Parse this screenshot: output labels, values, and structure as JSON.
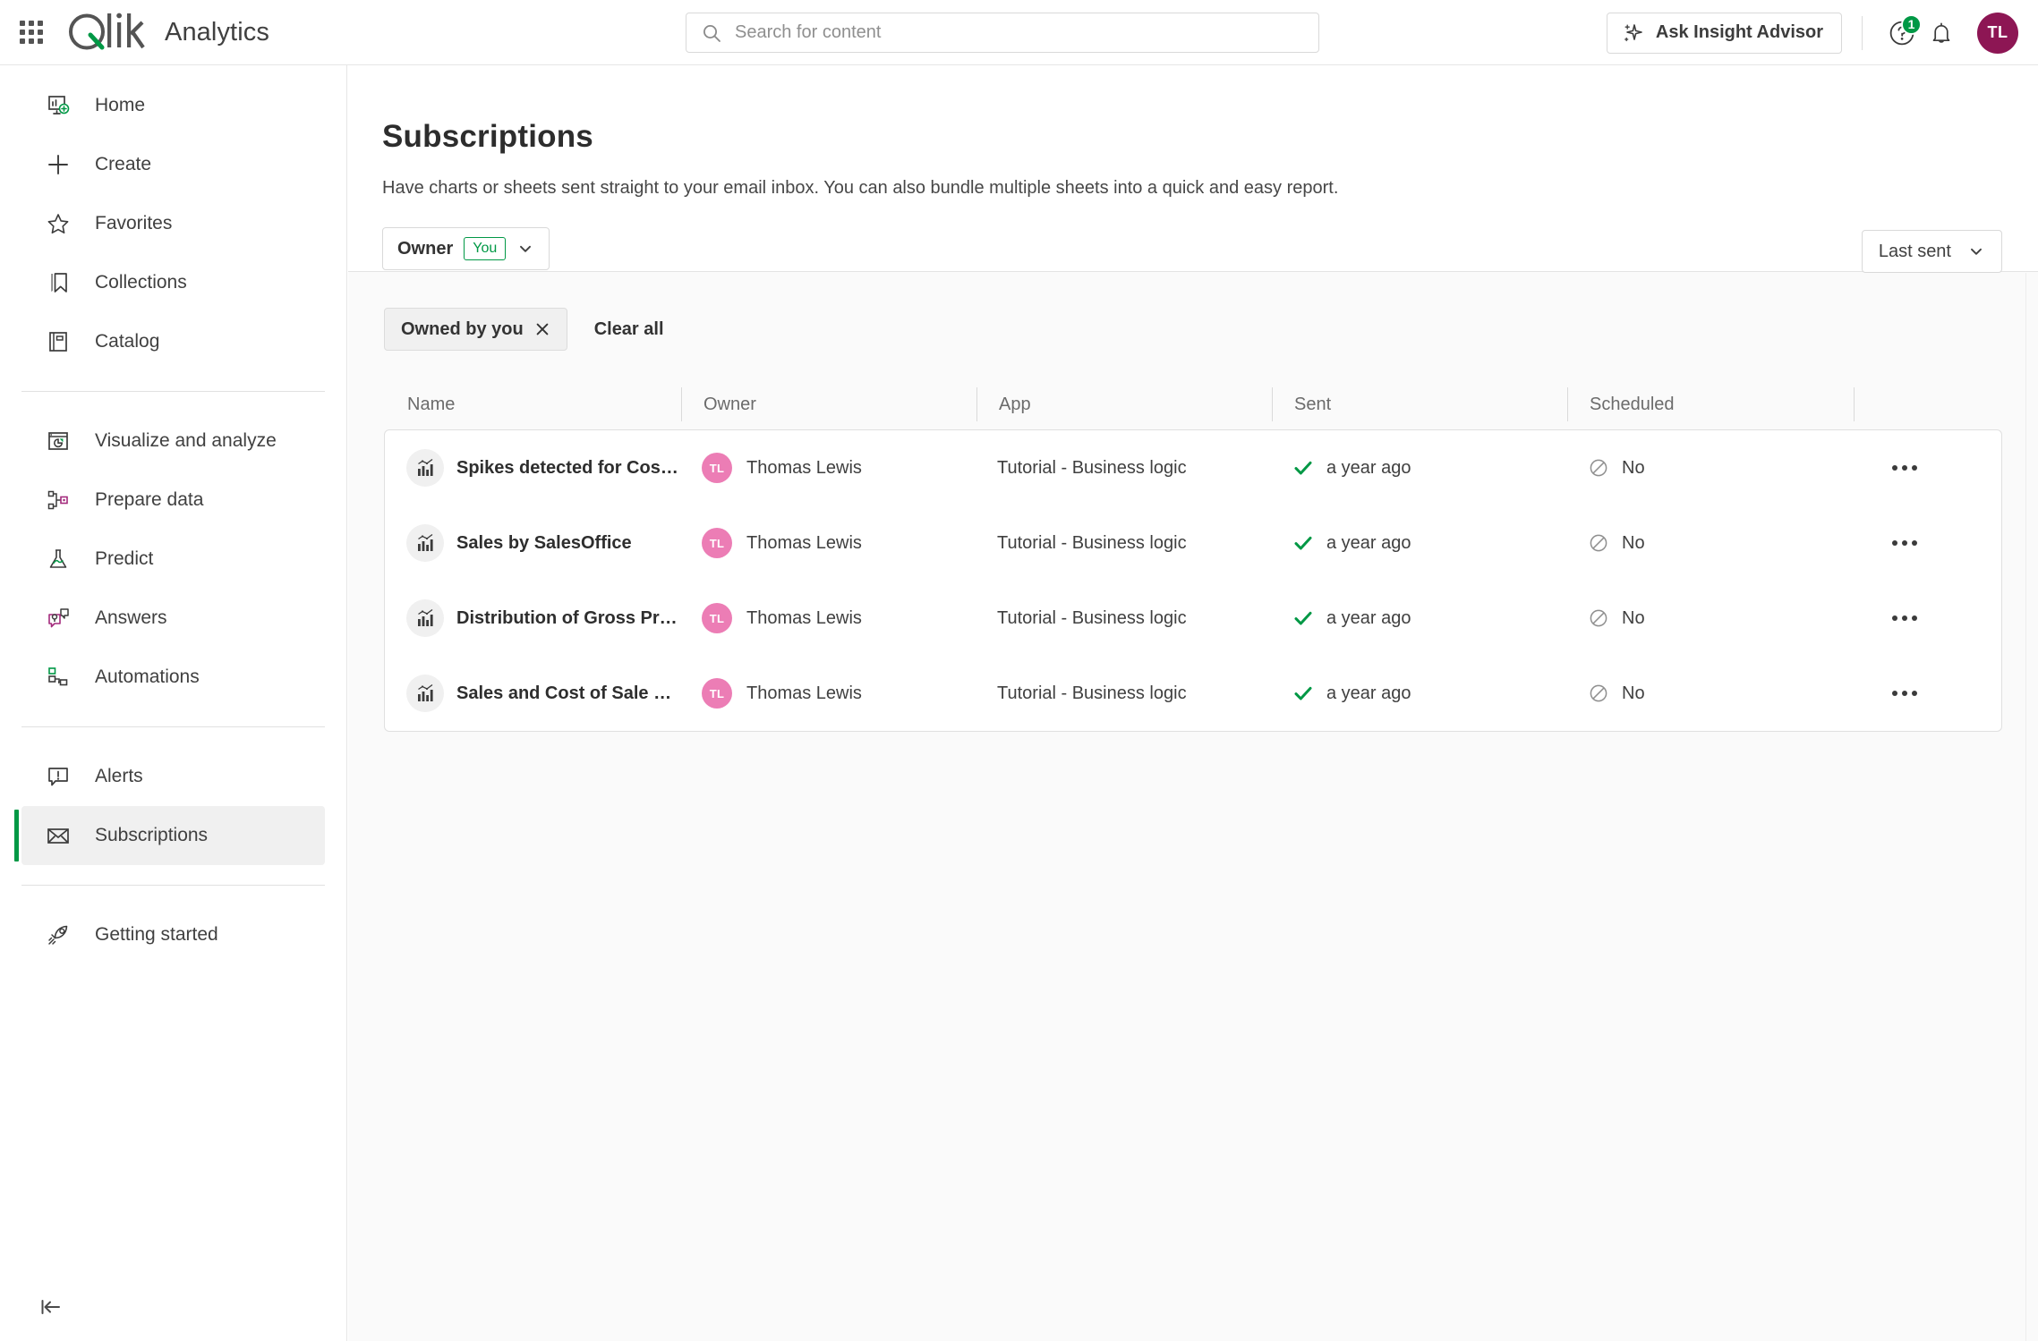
{
  "topbar": {
    "app_switcher": "app-switcher",
    "brand_name": "Analytics",
    "search_placeholder": "Search for content",
    "search_value": "",
    "advisor_label": "Ask Insight Advisor",
    "help_badge": "1",
    "avatar_initials": "TL"
  },
  "sidebar": {
    "groups": [
      {
        "items": [
          {
            "label": "Home",
            "icon": "home-dashboard-icon",
            "active": false
          },
          {
            "label": "Create",
            "icon": "plus-icon",
            "active": false
          },
          {
            "label": "Favorites",
            "icon": "star-icon",
            "active": false
          },
          {
            "label": "Collections",
            "icon": "bookmark-icon",
            "active": false
          },
          {
            "label": "Catalog",
            "icon": "book-icon",
            "active": false
          }
        ]
      },
      {
        "items": [
          {
            "label": "Visualize and analyze",
            "icon": "chart-window-icon",
            "active": false
          },
          {
            "label": "Prepare data",
            "icon": "data-nodes-icon",
            "active": false
          },
          {
            "label": "Predict",
            "icon": "flask-icon",
            "active": false
          },
          {
            "label": "Answers",
            "icon": "chat-bubbles-icon",
            "active": false
          },
          {
            "label": "Automations",
            "icon": "automation-flow-icon",
            "active": false
          }
        ]
      },
      {
        "items": [
          {
            "label": "Alerts",
            "icon": "alert-bubble-icon",
            "active": false
          },
          {
            "label": "Subscriptions",
            "icon": "envelope-icon",
            "active": true
          }
        ]
      },
      {
        "items": [
          {
            "label": "Getting started",
            "icon": "rocket-icon",
            "active": false
          }
        ]
      }
    ],
    "collapse_label": "collapse-sidebar"
  },
  "page": {
    "title": "Subscriptions",
    "description": "Have charts or sheets sent straight to your email inbox. You can also bundle multiple sheets into a quick and easy report.",
    "owner_filter_label": "Owner",
    "owner_filter_value": "You",
    "sort_label": "Last sent",
    "active_chips": [
      "Owned by you"
    ],
    "clear_all_label": "Clear all"
  },
  "table": {
    "columns": [
      "Name",
      "Owner",
      "App",
      "Sent",
      "Scheduled",
      ""
    ],
    "rows": [
      {
        "name": "Spikes detected for Cos…",
        "owner": "Thomas Lewis",
        "owner_initials": "TL",
        "app": "Tutorial - Business logic",
        "sent": "a year ago",
        "scheduled": "No"
      },
      {
        "name": "Sales by SalesOffice",
        "owner": "Thomas Lewis",
        "owner_initials": "TL",
        "app": "Tutorial - Business logic",
        "sent": "a year ago",
        "scheduled": "No"
      },
      {
        "name": "Distribution of Gross Pr…",
        "owner": "Thomas Lewis",
        "owner_initials": "TL",
        "app": "Tutorial - Business logic",
        "sent": "a year ago",
        "scheduled": "No"
      },
      {
        "name": "Sales and Cost of Sale …",
        "owner": "Thomas Lewis",
        "owner_initials": "TL",
        "app": "Tutorial - Business logic",
        "sent": "a year ago",
        "scheduled": "No"
      }
    ]
  },
  "colors": {
    "brand_green": "#009845",
    "avatar_purple": "#8d1654",
    "avatar_pink": "#ec7db5",
    "sent_check_green": "#009845"
  }
}
